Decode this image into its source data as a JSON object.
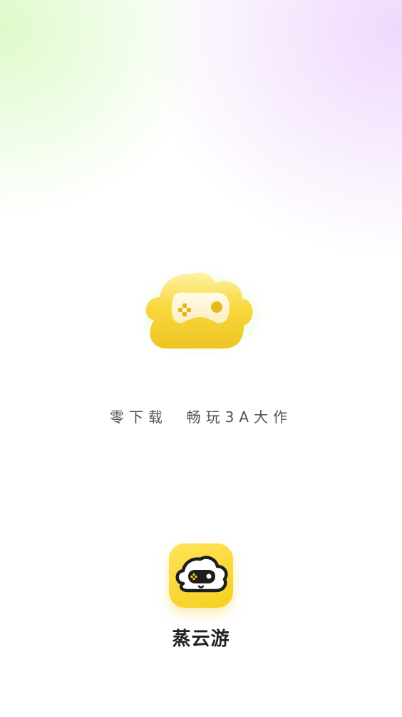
{
  "splash": {
    "slogan": "零下载  畅玩3A大作",
    "app_name": "蒸云游"
  },
  "icons": {
    "hero": "cloud-gamepad-icon",
    "app": "app-logo-cloud-icon"
  },
  "colors": {
    "cloud_yellow": "#f6d23a",
    "glow_green": "#b4f578",
    "icon_yellow": "#f7cf1e",
    "text_dark": "#222222",
    "text_gray": "#505050"
  }
}
